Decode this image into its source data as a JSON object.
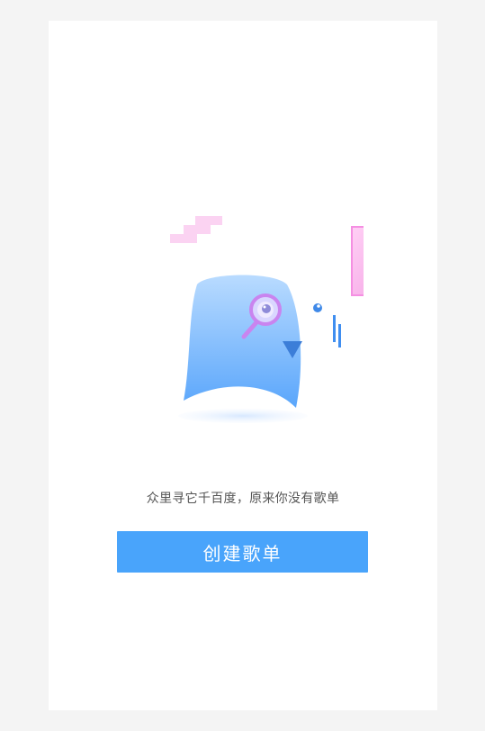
{
  "empty_state": {
    "message": "众里寻它千百度，原来你没有歌单",
    "illustration_icon": "searching-mascot-icon"
  },
  "actions": {
    "create_playlist_label": "创建歌单"
  },
  "colors": {
    "background": "#f4f4f4",
    "card": "#ffffff",
    "accent": "#49a4fb",
    "mascot_blue": "#7dbcff",
    "pink": "#f7a8e6"
  }
}
